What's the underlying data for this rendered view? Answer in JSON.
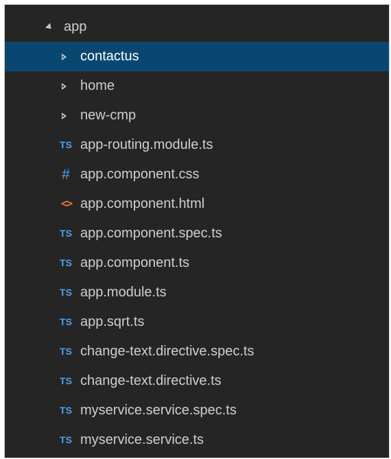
{
  "explorer": {
    "root_folder": "app",
    "items": [
      {
        "type": "folder",
        "label": "contactus",
        "selected": true,
        "icon": "chevron-right-icon"
      },
      {
        "type": "folder",
        "label": "home",
        "selected": false,
        "icon": "chevron-right-icon"
      },
      {
        "type": "folder",
        "label": "new-cmp",
        "selected": false,
        "icon": "chevron-right-icon"
      },
      {
        "type": "file",
        "label": "app-routing.module.ts",
        "badge": "TS",
        "icon": "typescript-file-icon"
      },
      {
        "type": "file",
        "label": "app.component.css",
        "badge": "#",
        "icon": "css-file-icon"
      },
      {
        "type": "file",
        "label": "app.component.html",
        "badge": "<>",
        "icon": "html-file-icon"
      },
      {
        "type": "file",
        "label": "app.component.spec.ts",
        "badge": "TS",
        "icon": "typescript-file-icon"
      },
      {
        "type": "file",
        "label": "app.component.ts",
        "badge": "TS",
        "icon": "typescript-file-icon"
      },
      {
        "type": "file",
        "label": "app.module.ts",
        "badge": "TS",
        "icon": "typescript-file-icon"
      },
      {
        "type": "file",
        "label": "app.sqrt.ts",
        "badge": "TS",
        "icon": "typescript-file-icon"
      },
      {
        "type": "file",
        "label": "change-text.directive.spec.ts",
        "badge": "TS",
        "icon": "typescript-file-icon"
      },
      {
        "type": "file",
        "label": "change-text.directive.ts",
        "badge": "TS",
        "icon": "typescript-file-icon"
      },
      {
        "type": "file",
        "label": "myservice.service.spec.ts",
        "badge": "TS",
        "icon": "typescript-file-icon"
      },
      {
        "type": "file",
        "label": "myservice.service.ts",
        "badge": "TS",
        "icon": "typescript-file-icon"
      }
    ]
  },
  "colors": {
    "background": "#252526",
    "selected_row": "#094771",
    "text": "#ccd0d3",
    "ts_icon": "#4fa2e8",
    "css_icon": "#4fa2e8",
    "html_icon": "#e4703b"
  }
}
